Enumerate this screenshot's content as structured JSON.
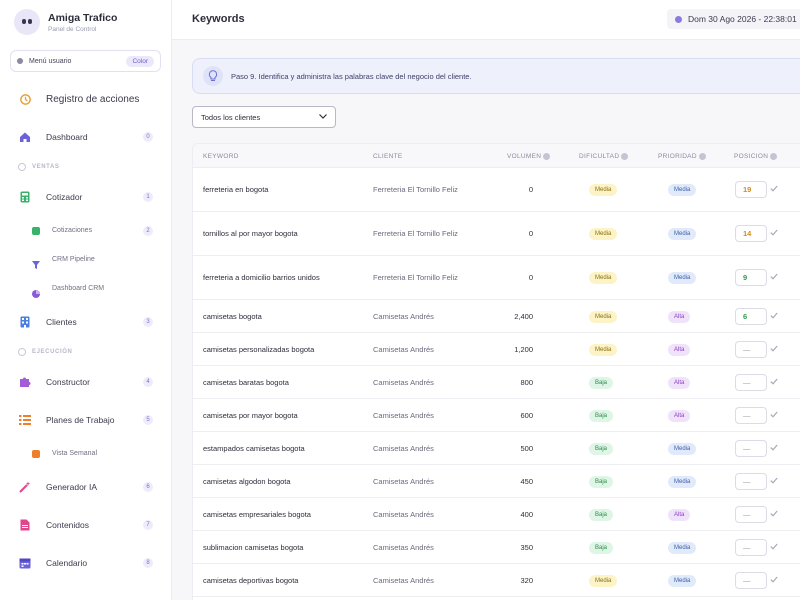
{
  "brand": {
    "name": "Amiga Trafico",
    "subtitle": "Panel de Control"
  },
  "user_menu": {
    "label": "Menú usuario",
    "pill": "Color"
  },
  "sidebar": {
    "activity": {
      "label": "Registro de acciones",
      "icon": "history-icon"
    },
    "dashboard": {
      "label": "Dashboard",
      "count": "0"
    },
    "section_ventas": "VENTAS",
    "cotizador": {
      "label": "Cotizador",
      "count": "1"
    },
    "cotizaciones": {
      "label": "Cotizaciones",
      "count": "2"
    },
    "crm_pipeline": {
      "label": "CRM Pipeline"
    },
    "dashboard_crm": {
      "label": "Dashboard CRM"
    },
    "clientes": {
      "label": "Clientes",
      "count": "3"
    },
    "section_ejecucion": "EJECUCIÓN",
    "constructor": {
      "label": "Constructor",
      "count": "4"
    },
    "planes": {
      "label": "Planes de Trabajo",
      "count": "5"
    },
    "vista_semanal": {
      "label": "Vista Semanal"
    },
    "generador": {
      "label": "Generador IA",
      "count": "6"
    },
    "contenidos": {
      "label": "Contenidos",
      "count": "7"
    },
    "calendario": {
      "label": "Calendario",
      "count": "8"
    }
  },
  "header": {
    "title": "Keywords",
    "datetime": "Dom 30 Ago 2026 - 22:38:01"
  },
  "banner": {
    "text": "Paso 9. Identifica y administra las palabras clave del negocio del cliente."
  },
  "filter": {
    "selected": "Todos los clientes"
  },
  "table": {
    "columns": {
      "keyword": "KEYWORD",
      "client": "CLIENTE",
      "volume": "VOLUMEN",
      "difficulty": "DIFICULTAD",
      "priority": "PRIORIDAD",
      "position": "POSICION"
    },
    "rows": [
      {
        "keyword": "ferreteria en bogota",
        "client": "Ferreteria El Tornillo Feliz",
        "volume": "0",
        "difficulty": "Media",
        "priority": "Media",
        "position": "19",
        "pos_color": "#d38b1a"
      },
      {
        "keyword": "tornillos al por mayor bogota",
        "client": "Ferreteria El Tornillo Feliz",
        "volume": "0",
        "difficulty": "Media",
        "priority": "Media",
        "position": "14",
        "pos_color": "#d38b1a"
      },
      {
        "keyword": "ferreteria a domicilio barrios unidos",
        "client": "Ferreteria El Tornillo Feliz",
        "volume": "0",
        "difficulty": "Media",
        "priority": "Media",
        "position": "9",
        "pos_color": "#2f9a52"
      },
      {
        "keyword": "camisetas bogota",
        "client": "Camisetas Andrés",
        "volume": "2,400",
        "difficulty": "Media",
        "priority": "Alta",
        "position": "6",
        "pos_color": "#2f9a52"
      },
      {
        "keyword": "camisetas personalizadas bogota",
        "client": "Camisetas Andrés",
        "volume": "1,200",
        "difficulty": "Media",
        "priority": "Alta",
        "position": "—",
        "pos_color": "#9a9aa8"
      },
      {
        "keyword": "camisetas baratas bogota",
        "client": "Camisetas Andrés",
        "volume": "800",
        "difficulty": "Baja",
        "priority": "Alta",
        "position": "—",
        "pos_color": "#9a9aa8"
      },
      {
        "keyword": "camisetas por mayor bogota",
        "client": "Camisetas Andrés",
        "volume": "600",
        "difficulty": "Baja",
        "priority": "Alta",
        "position": "—",
        "pos_color": "#9a9aa8"
      },
      {
        "keyword": "estampados camisetas bogota",
        "client": "Camisetas Andrés",
        "volume": "500",
        "difficulty": "Baja",
        "priority": "Media",
        "position": "—",
        "pos_color": "#9a9aa8"
      },
      {
        "keyword": "camisetas algodon bogota",
        "client": "Camisetas Andrés",
        "volume": "450",
        "difficulty": "Baja",
        "priority": "Media",
        "position": "—",
        "pos_color": "#9a9aa8"
      },
      {
        "keyword": "camisetas empresariales bogota",
        "client": "Camisetas Andrés",
        "volume": "400",
        "difficulty": "Baja",
        "priority": "Alta",
        "position": "—",
        "pos_color": "#9a9aa8"
      },
      {
        "keyword": "sublimacion camisetas bogota",
        "client": "Camisetas Andrés",
        "volume": "350",
        "difficulty": "Baja",
        "priority": "Media",
        "position": "—",
        "pos_color": "#9a9aa8"
      },
      {
        "keyword": "camisetas deportivas bogota",
        "client": "Camisetas Andrés",
        "volume": "320",
        "difficulty": "Media",
        "priority": "Media",
        "position": "—",
        "pos_color": "#9a9aa8"
      }
    ]
  },
  "colors": {
    "accent": "#7b6ee0",
    "sidebar_bg": "#ffffff",
    "page_bg": "#f7f7fa"
  }
}
